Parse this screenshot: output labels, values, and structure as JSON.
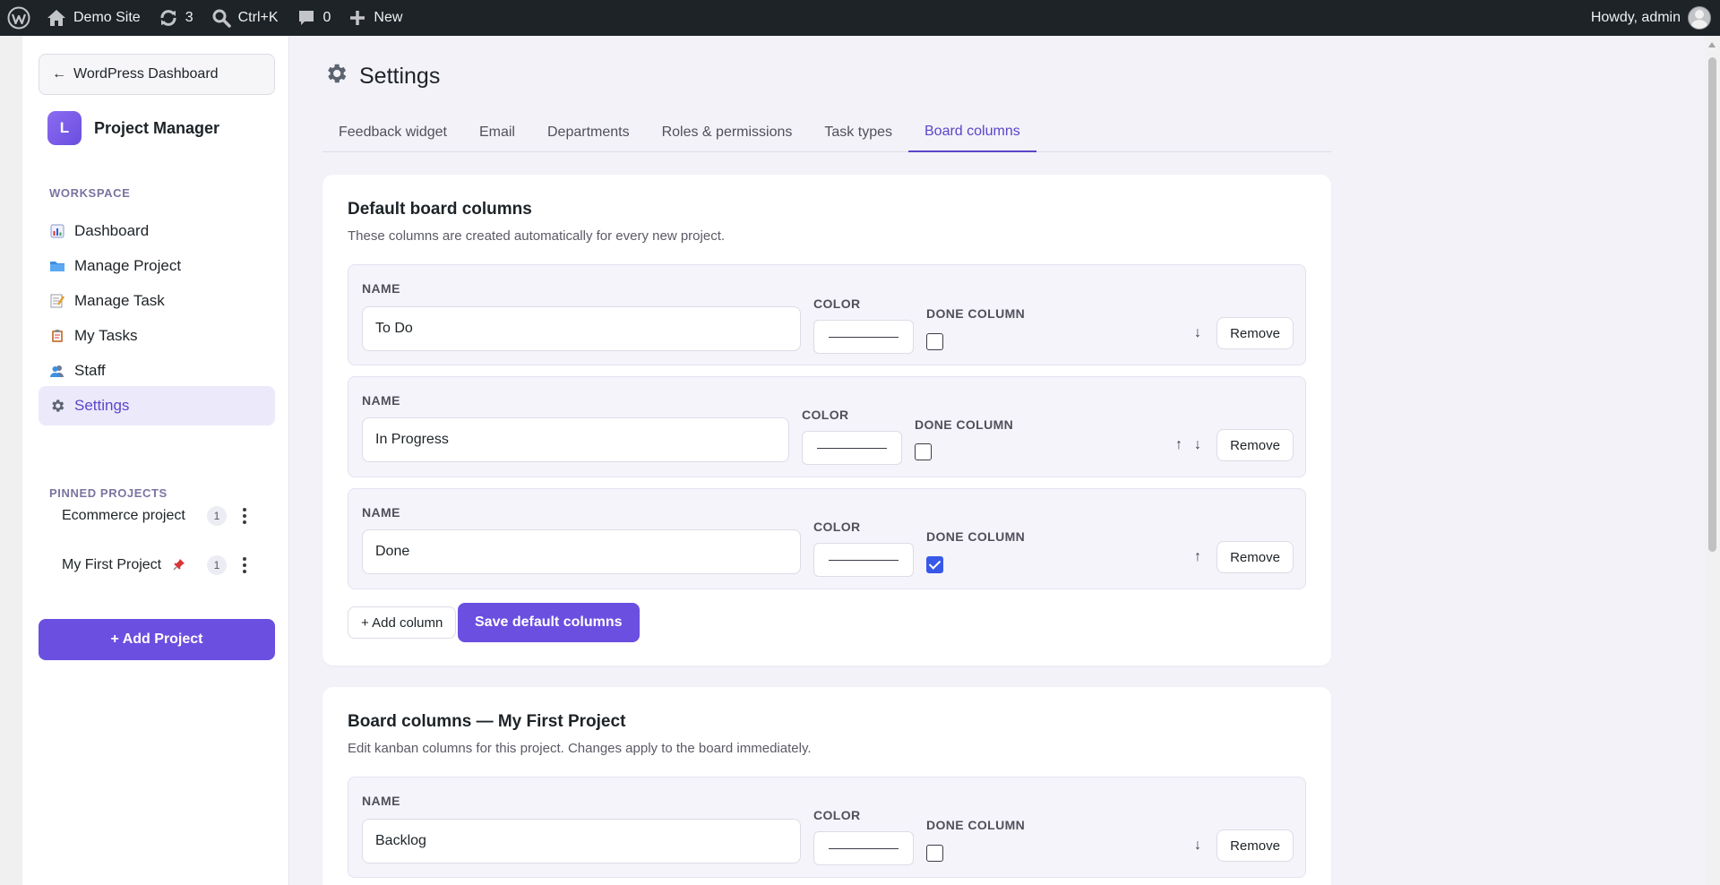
{
  "adminbar": {
    "site_name": "Demo Site",
    "updates_count": "3",
    "search_shortcut": "Ctrl+K",
    "comments_count": "0",
    "new_label": "New",
    "howdy": "Howdy, admin"
  },
  "sidebar": {
    "back_label": "WordPress Dashboard",
    "back_arrow": "←",
    "brand_initial": "L",
    "brand_name": "Project Manager",
    "workspace_label": "WORKSPACE",
    "nav": [
      {
        "label": "Dashboard",
        "icon": "bar-chart-icon"
      },
      {
        "label": "Manage Project",
        "icon": "folder-icon"
      },
      {
        "label": "Manage Task",
        "icon": "memo-icon"
      },
      {
        "label": "My Tasks",
        "icon": "clipboard-icon"
      },
      {
        "label": "Staff",
        "icon": "people-icon"
      },
      {
        "label": "Settings",
        "icon": "gear-icon"
      }
    ],
    "pinned_label": "PINNED PROJECTS",
    "pinned": [
      {
        "name": "Ecommerce project",
        "count": "1",
        "pinned_icon": false
      },
      {
        "name": "My First Project",
        "count": "1",
        "pinned_icon": true
      }
    ],
    "add_project_label": "+ Add Project"
  },
  "main": {
    "title": "Settings",
    "tabs": [
      "Feedback widget",
      "Email",
      "Departments",
      "Roles & permissions",
      "Task types",
      "Board columns"
    ],
    "active_tab": "Board columns",
    "labels": {
      "name": "NAME",
      "color": "COLOR",
      "done": "DONE COLUMN",
      "remove": "Remove",
      "up": "↑",
      "down": "↓"
    },
    "default_card": {
      "title": "Default board columns",
      "description": "These columns are created automatically for every new project.",
      "columns": [
        {
          "name": "To Do",
          "done": false
        },
        {
          "name": "In Progress",
          "done": false
        },
        {
          "name": "Done",
          "done": true
        }
      ],
      "add_column_label": "+ Add column",
      "save_label": "Save default columns"
    },
    "project_card": {
      "title": "Board columns — My First Project",
      "description": "Edit kanban columns for this project. Changes apply to the board immediately.",
      "columns": [
        {
          "name": "Backlog",
          "done": false
        }
      ]
    }
  }
}
